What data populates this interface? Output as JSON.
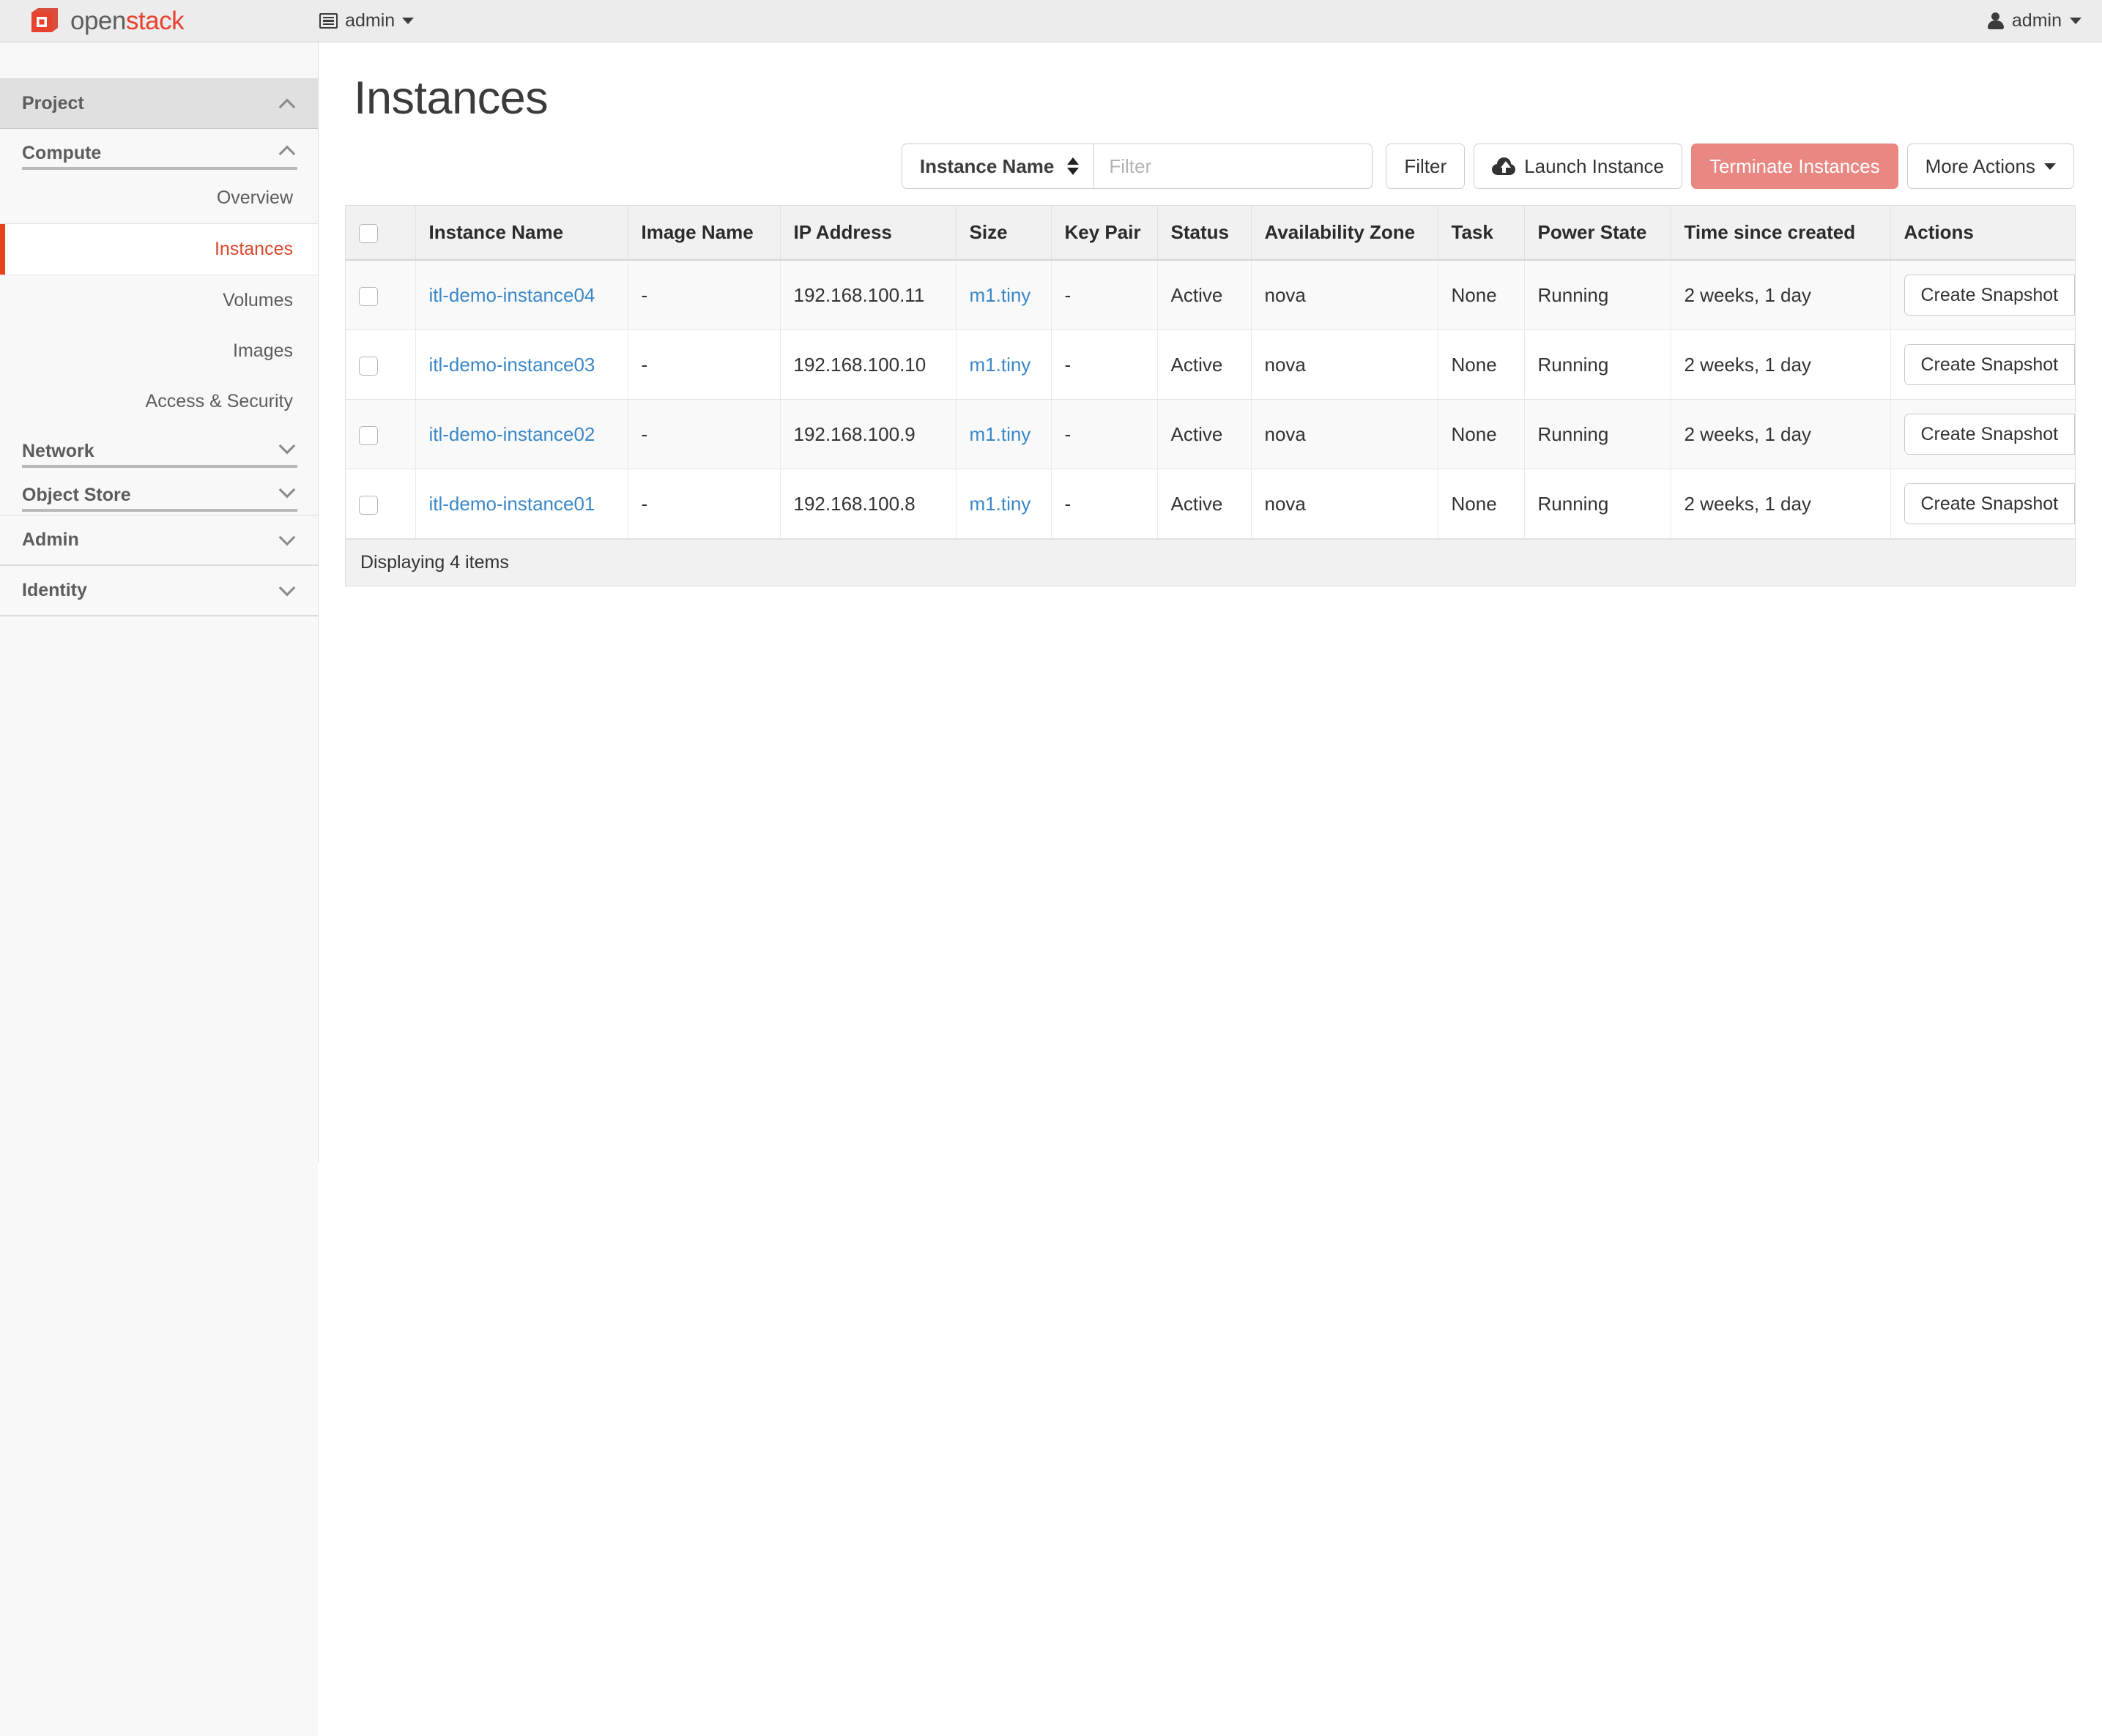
{
  "navbar": {
    "brand": {
      "open": "open",
      "stack": "stack"
    },
    "project_selector": {
      "label": "admin",
      "icon": "list-icon"
    },
    "user_menu": {
      "label": "admin",
      "icon": "person-icon"
    }
  },
  "sidebar": {
    "sections": [
      {
        "label": "Project",
        "level": 1,
        "state": "expanded",
        "active": true
      },
      {
        "label": "Compute",
        "level": 2,
        "state": "expanded"
      },
      {
        "label": "Network",
        "level": 2,
        "state": "collapsed"
      },
      {
        "label": "Object Store",
        "level": 2,
        "state": "collapsed"
      },
      {
        "label": "Admin",
        "level": 1,
        "state": "collapsed"
      },
      {
        "label": "Identity",
        "level": 1,
        "state": "collapsed"
      }
    ],
    "compute_links": [
      {
        "label": "Overview",
        "active": false
      },
      {
        "label": "Instances",
        "active": true
      },
      {
        "label": "Volumes",
        "active": false
      },
      {
        "label": "Images",
        "active": false
      },
      {
        "label": "Access & Security",
        "active": false
      }
    ]
  },
  "page": {
    "title": "Instances"
  },
  "toolbar": {
    "filter_select_value": "Instance Name",
    "filter_placeholder": "Filter",
    "filter_value": "",
    "filter_button": "Filter",
    "launch_button": "Launch Instance",
    "terminate_button": "Terminate Instances",
    "more_actions_button": "More Actions",
    "danger_color": "#e98782",
    "link_color": "#3a87c8"
  },
  "table": {
    "columns": [
      "Instance Name",
      "Image Name",
      "IP Address",
      "Size",
      "Key Pair",
      "Status",
      "Availability Zone",
      "Task",
      "Power State",
      "Time since created",
      "Actions"
    ],
    "rows": [
      {
        "name": "itl-demo-instance04",
        "image": "-",
        "ip": "192.168.100.11",
        "size": "m1.tiny",
        "keypair": "-",
        "status": "Active",
        "az": "nova",
        "task": "None",
        "power": "Running",
        "time": "2 weeks, 1 day",
        "action": "Create Snapshot"
      },
      {
        "name": "itl-demo-instance03",
        "image": "-",
        "ip": "192.168.100.10",
        "size": "m1.tiny",
        "keypair": "-",
        "status": "Active",
        "az": "nova",
        "task": "None",
        "power": "Running",
        "time": "2 weeks, 1 day",
        "action": "Create Snapshot"
      },
      {
        "name": "itl-demo-instance02",
        "image": "-",
        "ip": "192.168.100.9",
        "size": "m1.tiny",
        "keypair": "-",
        "status": "Active",
        "az": "nova",
        "task": "None",
        "power": "Running",
        "time": "2 weeks, 1 day",
        "action": "Create Snapshot"
      },
      {
        "name": "itl-demo-instance01",
        "image": "-",
        "ip": "192.168.100.8",
        "size": "m1.tiny",
        "keypair": "-",
        "status": "Active",
        "az": "nova",
        "task": "None",
        "power": "Running",
        "time": "2 weeks, 1 day",
        "action": "Create Snapshot"
      }
    ],
    "footer": "Displaying 4 items"
  }
}
